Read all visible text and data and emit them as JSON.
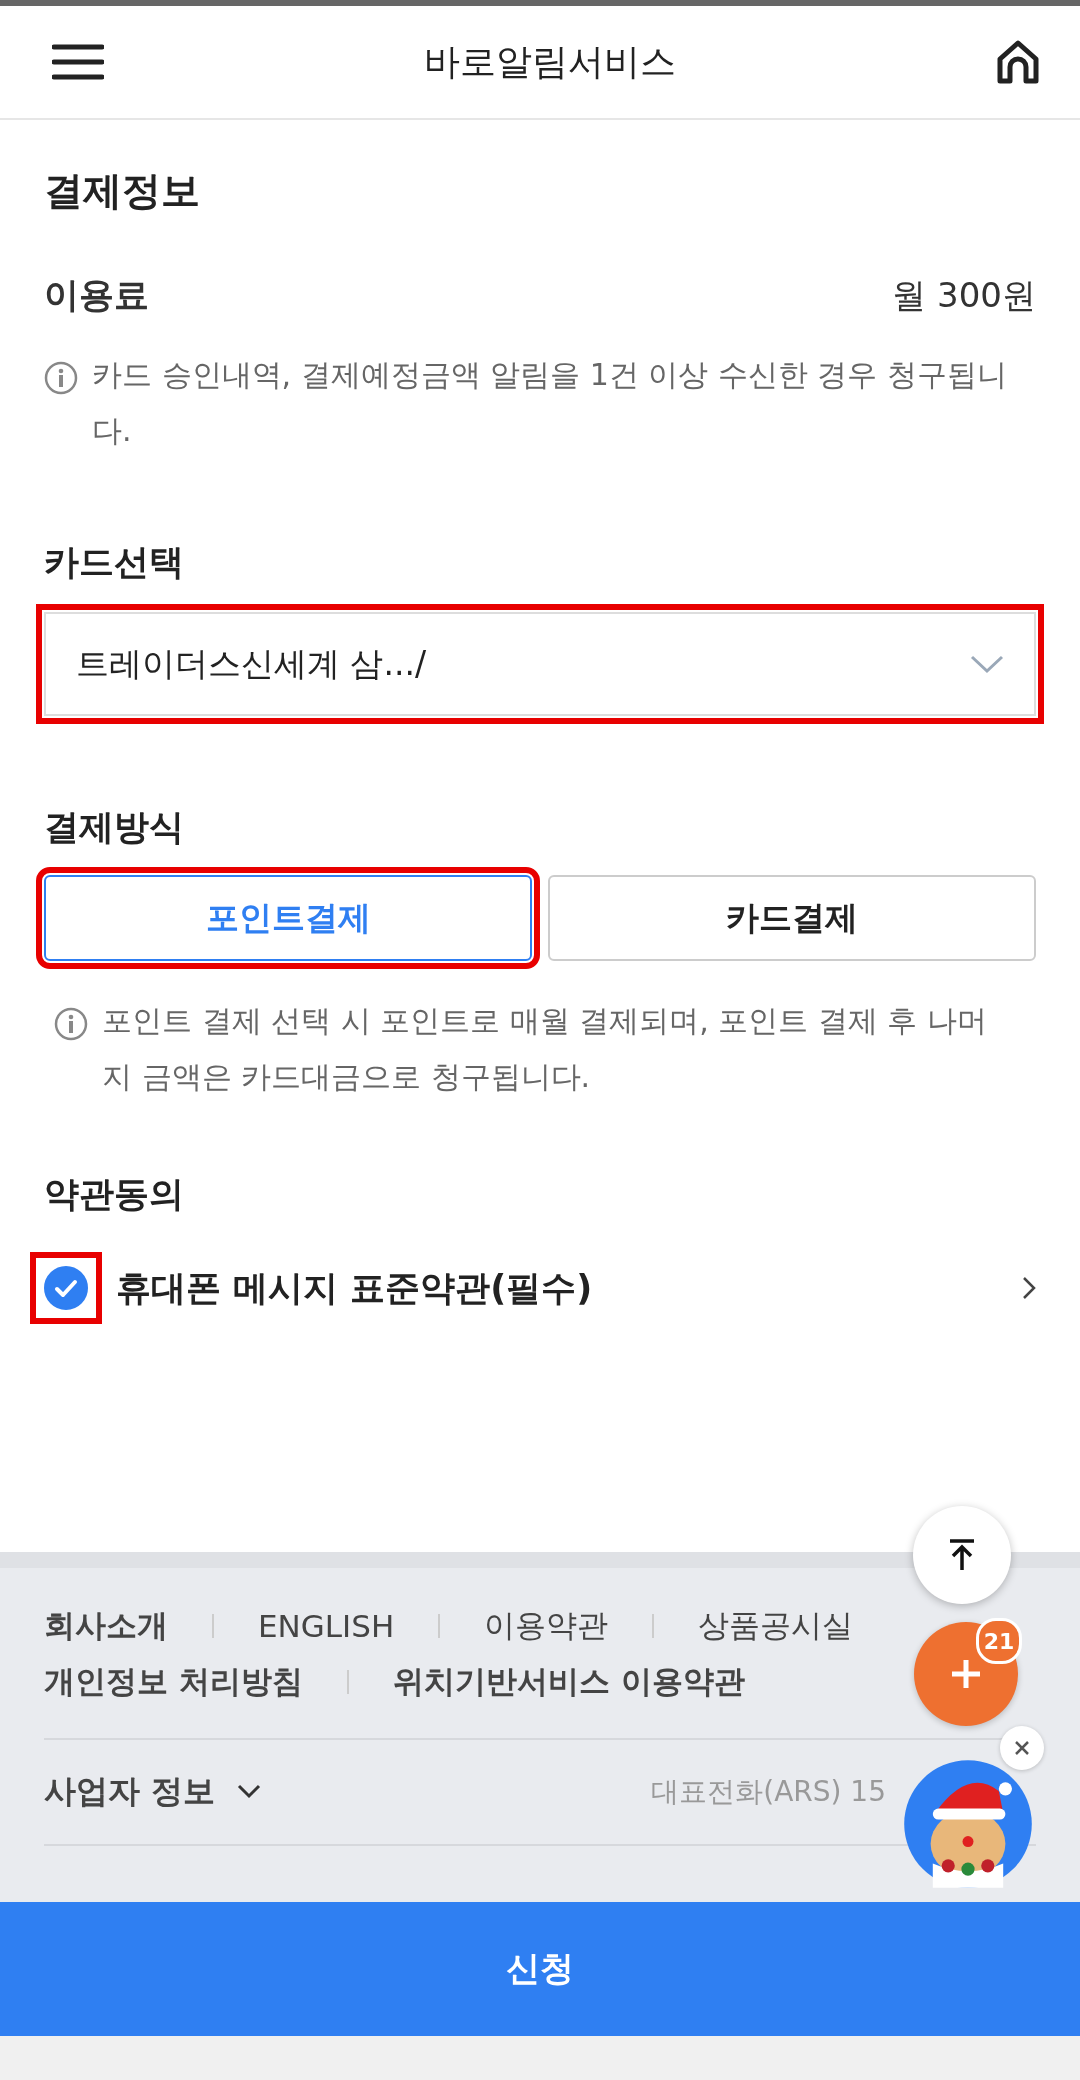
{
  "header": {
    "title": "바로알림서비스"
  },
  "section_title": "결제정보",
  "fee": {
    "label": "이용료",
    "value": "월 300원"
  },
  "fee_note": "카드 승인내역, 결제예정금액 알림을 1건 이상 수신한 경우 청구됩니다.",
  "card_select": {
    "label": "카드선택",
    "value": "트레이더스신세계 삼.../",
    "highlighted": true
  },
  "payment": {
    "label": "결제방식",
    "options": [
      {
        "label": "포인트결제",
        "selected": true,
        "highlighted": true
      },
      {
        "label": "카드결제",
        "selected": false,
        "highlighted": false
      }
    ]
  },
  "payment_note": "포인트 결제 선택 시 포인트로 매월 결제되며, 포인트 결제 후 나머지 금액은 카드대금으로 청구됩니다.",
  "terms": {
    "label": "약관동의",
    "items": [
      {
        "label": "휴대폰 메시지 표준약관(필수)",
        "checked": true,
        "highlighted": true
      }
    ]
  },
  "footer": {
    "links": [
      [
        "회사소개",
        "ENGLISH",
        "이용약관",
        "상품공시실"
      ],
      [
        "개인정보 처리방침",
        "위치기반서비스 이용약관"
      ]
    ],
    "business_info": "사업자 정보",
    "phone": "대표전화(ARS) 15"
  },
  "fab": {
    "badge": "21"
  },
  "submit": "신청"
}
